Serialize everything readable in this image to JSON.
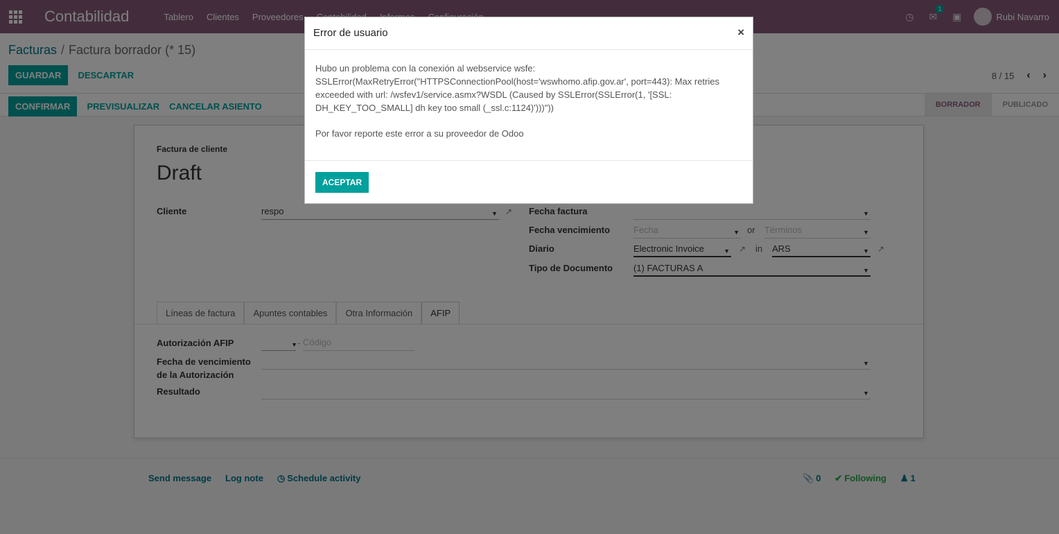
{
  "navbar": {
    "app_name": "Contabilidad",
    "menu": [
      "Tablero",
      "Clientes",
      "Proveedores",
      "Contabilidad",
      "Informes",
      "Configuración"
    ],
    "messages_badge": "1",
    "user_name": "Rubi Navarro"
  },
  "breadcrumb": {
    "parent": "Facturas",
    "separator": "/",
    "current": "Factura borrador (* 15)"
  },
  "buttons": {
    "save": "GUARDAR",
    "discard": "DESCARTAR",
    "confirm": "CONFIRMAR",
    "preview": "PREVISUALIZAR",
    "cancel_entry": "CANCELAR ASIENTO"
  },
  "pager": {
    "value": "8 / 15",
    "prev": "‹",
    "next": "›"
  },
  "status": {
    "stages": [
      "BORRADOR",
      "PUBLICADO"
    ],
    "active": "BORRADOR"
  },
  "form": {
    "type_label": "Factura de cliente",
    "title": "Draft",
    "client_label": "Cliente",
    "client_value": "respo",
    "invoice_date_label": "Fecha factura",
    "invoice_date_value": "",
    "due_date_label": "Fecha vencimiento",
    "due_date_placeholder": "Fecha",
    "or_text": "or",
    "terms_placeholder": "Términos",
    "journal_label": "Diario",
    "journal_value": "Electronic Invoice",
    "in_text": "in",
    "currency_value": "ARS",
    "doc_type_label": "Tipo de Documento",
    "doc_type_value": "(1) FACTURAS A"
  },
  "tabs": [
    "Líneas de factura",
    "Apuntes contables",
    "Otra Información",
    "AFIP"
  ],
  "active_tab": "AFIP",
  "afip": {
    "auth_label": "Autorización AFIP",
    "dash": "-",
    "code_placeholder": "Código",
    "expiry_label_line1": "Fecha de vencimiento",
    "expiry_label_line2": "de la Autorización",
    "result_label": "Resultado"
  },
  "chatter": {
    "send_message": "Send message",
    "log_note": "Log note",
    "schedule_activity": "Schedule activity",
    "attachments": "0",
    "following": "Following",
    "followers": "1"
  },
  "modal": {
    "title": "Error de usuario",
    "close": "×",
    "message": "Hubo un problema con la conexión al webservice wsfe: SSLError(MaxRetryError(\"HTTPSConnectionPool(host='wswhomo.afip.gov.ar', port=443): Max retries exceeded with url: /wsfev1/service.asmx?WSDL (Caused by SSLError(SSLError(1, '[SSL: DH_KEY_TOO_SMALL] dh key too small (_ssl.c:1124)')))\"))",
    "note": "Por favor reporte este error a su proveedor de Odoo",
    "accept": "ACEPTAR"
  },
  "colors": {
    "navbar": "#875a7b",
    "primary": "#00a09d",
    "link": "#00758a"
  }
}
